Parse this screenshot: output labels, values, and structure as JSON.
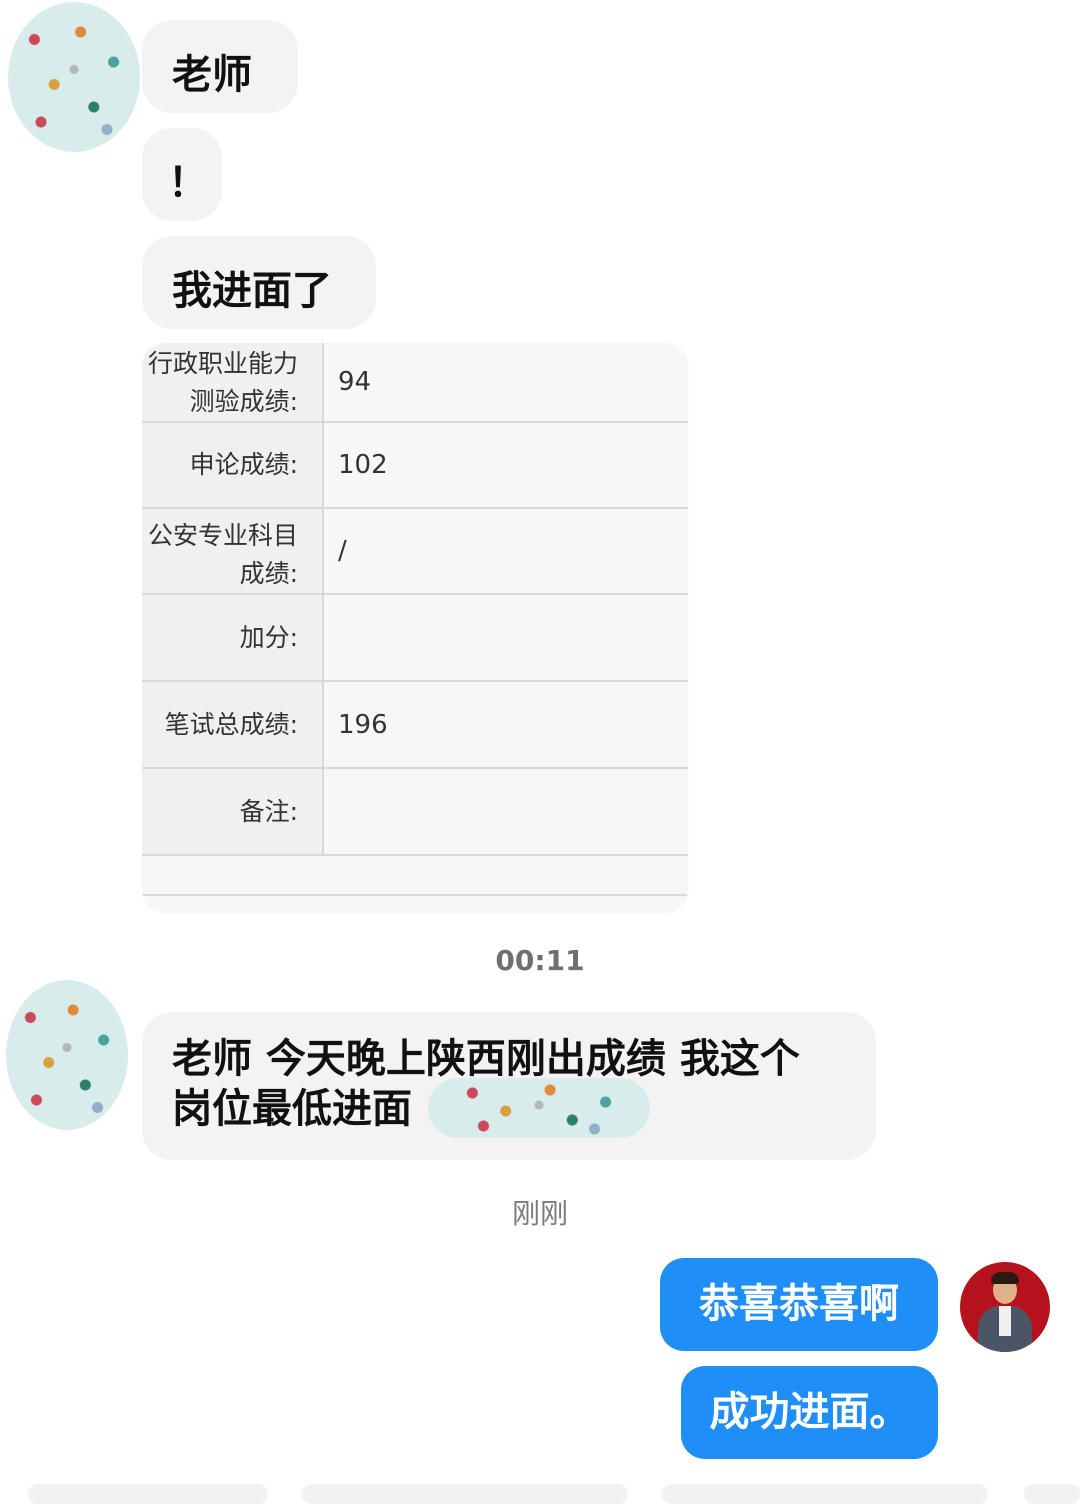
{
  "messages": {
    "m1": "老师",
    "m2": "！",
    "m3": "我进面了",
    "m4_line1": "老师 今天晚上陕西刚出成绩 我这个",
    "m4_line2": "岗位最低进面",
    "reply1": "恭喜恭喜啊",
    "reply2": "成功进面。"
  },
  "timestamps": {
    "t1": "00:11",
    "t2": "刚刚"
  },
  "score_table": {
    "rows": [
      {
        "label_line1": "行政职业能力",
        "label_line2": "测验成绩:",
        "value": "94"
      },
      {
        "label_line1": "申论成绩:",
        "label_line2": "",
        "value": "102"
      },
      {
        "label_line1": "公安专业科目",
        "label_line2": "成绩:",
        "value": "/"
      },
      {
        "label_line1": "加分:",
        "label_line2": "",
        "value": ""
      },
      {
        "label_line1": "笔试总成绩:",
        "label_line2": "",
        "value": "196"
      },
      {
        "label_line1": "备注:",
        "label_line2": "",
        "value": ""
      }
    ]
  },
  "colors": {
    "incoming_bubble": "#f3f3f3",
    "outgoing_bubble": "#1f8ef6",
    "timestamp": "#7b7b7b"
  },
  "icons": {
    "student_avatar": "polka-dot-avatar-icon",
    "teacher_avatar": "teacher-photo-avatar-icon"
  }
}
